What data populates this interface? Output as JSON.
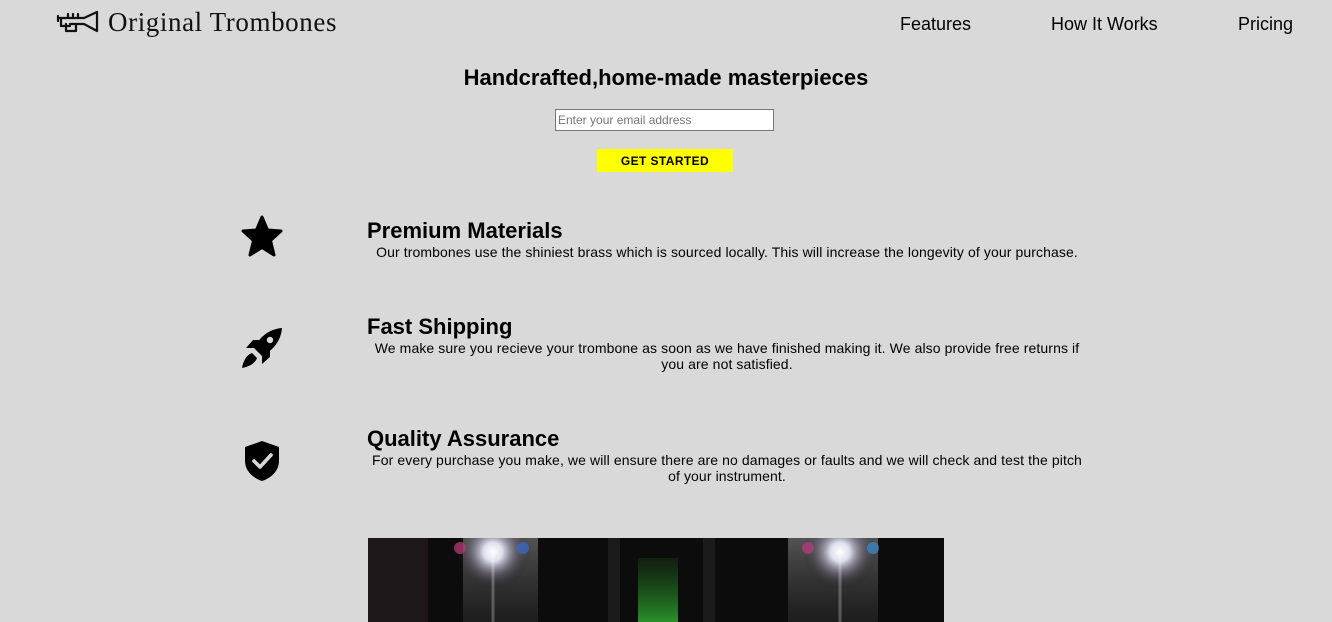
{
  "header": {
    "brand": "Original Trombones",
    "logo_icon": "trumpet-icon",
    "nav": [
      {
        "label": "Features"
      },
      {
        "label": "How It Works"
      },
      {
        "label": "Pricing"
      }
    ]
  },
  "hero": {
    "title": "Handcrafted,home-made masterpieces",
    "email_placeholder": "Enter your email address",
    "cta_label": "GET STARTED",
    "cta_color": "#ffff00"
  },
  "features": [
    {
      "icon": "star-icon",
      "title": "Premium Materials",
      "description": "Our trombones use the shiniest brass which is sourced locally. This will increase the longevity of your purchase."
    },
    {
      "icon": "rocket-icon",
      "title": "Fast Shipping",
      "description": "We make sure you recieve your trombone as soon as we have finished making it. We also provide free returns if you are not satisfied."
    },
    {
      "icon": "shield-check-icon",
      "title": "Quality Assurance",
      "description": "For every purchase you make, we will ensure there are no damages or faults and we will check and test the pitch of your instrument."
    }
  ],
  "video": {
    "thumbnail": "stage-lights-video"
  }
}
